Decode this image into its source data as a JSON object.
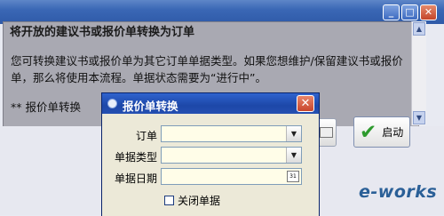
{
  "main": {
    "heading": "将开放的建议书或报价单转换为订单",
    "description": "您可转换建议书或报价单为其它订单单据类型。如果您想维护/保留建议书或报价单，那么将使用本流程。单据状态需要为“进行中”。",
    "footer": "** 报价单转换",
    "launch_label": "启动"
  },
  "window_controls": {
    "minimize": "_",
    "maximize": "□",
    "close": "✕"
  },
  "dialog": {
    "title": "报价单转换",
    "close_glyph": "✕",
    "fields": {
      "order_label": "订单",
      "order_value": "",
      "doctype_label": "单据类型",
      "doctype_value": "",
      "date_label": "单据日期",
      "date_value": "",
      "date_btn": "31"
    },
    "close_doc_label": "关闭单据",
    "close_doc_checked": false
  },
  "watermark": "e-works",
  "icons": {
    "dialog": "dialog-app-icon",
    "launch": "check-icon",
    "combo": "chevron-down-icon",
    "date": "calendar-icon",
    "print": "printer-icon"
  },
  "colors": {
    "titlebar": "#2f5aa8",
    "field_bg": "#fffde8",
    "launch_check": "#2e9a2e"
  }
}
